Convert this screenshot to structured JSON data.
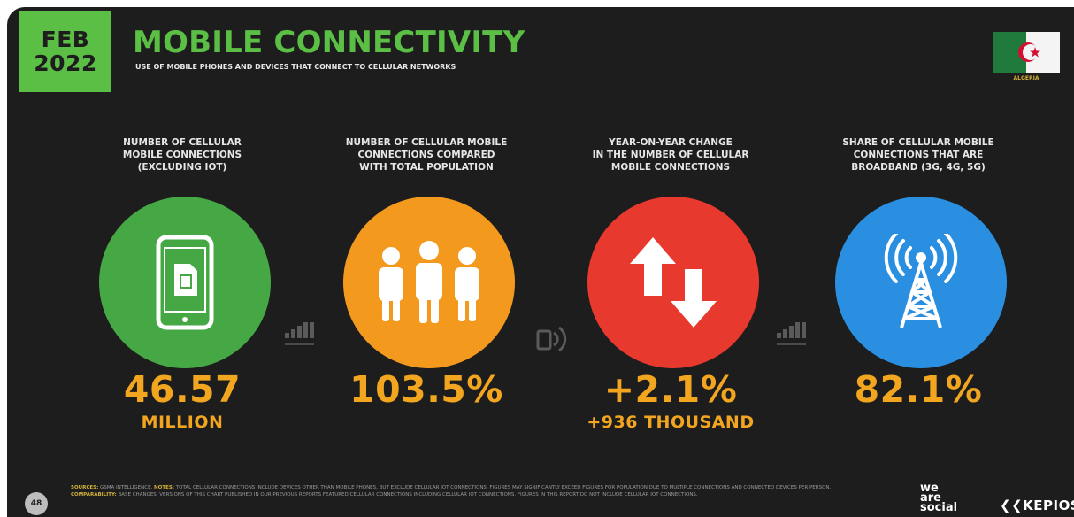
{
  "header": {
    "month": "FEB",
    "year": "2022",
    "title": "MOBILE CONNECTIVITY",
    "subtitle": "USE OF MOBILE PHONES AND DEVICES THAT CONNECT TO CELLULAR NETWORKS",
    "country": "ALGERIA",
    "flag_icon": "algeria-flag-icon"
  },
  "colors": {
    "brand_green": "#5bbf45",
    "accent_orange": "#f2a620",
    "circle_green": "#46a845",
    "circle_orange": "#f39a1e",
    "circle_red": "#e8392f",
    "circle_blue": "#2a8fe0",
    "background": "#1d1d1d"
  },
  "stats": [
    {
      "label": "NUMBER OF CELLULAR\nMOBILE CONNECTIONS\n(EXCLUDING IOT)",
      "icon": "mobile-phone-sim-icon",
      "value": "46.57",
      "sub": "MILLION"
    },
    {
      "label": "NUMBER OF CELLULAR MOBILE\nCONNECTIONS COMPARED\nWITH TOTAL POPULATION",
      "icon": "people-group-icon",
      "value": "103.5%",
      "sub": ""
    },
    {
      "label": "YEAR-ON-YEAR CHANGE\nIN THE NUMBER OF CELLULAR\nMOBILE CONNECTIONS",
      "icon": "up-down-arrows-icon",
      "value": "+2.1%",
      "sub": "+936 THOUSAND"
    },
    {
      "label": "SHARE OF CELLULAR MOBILE\nCONNECTIONS THAT ARE\nBROADBAND (3G, 4G, 5G)",
      "icon": "cell-tower-icon",
      "value": "82.1%",
      "sub": ""
    }
  ],
  "source_icons": [
    "gsma-intelligence-icon",
    "data-source-icon",
    "gsma-intelligence-icon"
  ],
  "footer": {
    "page_number": "48",
    "sources_label": "SOURCES:",
    "sources_text": "GSMA INTELLIGENCE.",
    "notes_label": "NOTES:",
    "notes_text": "TOTAL CELLULAR CONNECTIONS INCLUDE DEVICES OTHER THAN MOBILE PHONES, BUT EXCLUDE CELLULAR IOT CONNECTIONS. FIGURES MAY SIGNIFICANTLY EXCEED FIGURES FOR POPULATION DUE TO MULTIPLE CONNECTIONS AND CONNECTED DEVICES PER PERSON.",
    "comparability_label": "COMPARABILITY:",
    "comparability_text": "BASE CHANGES. VERSIONS OF THIS CHART PUBLISHED IN OUR PREVIOUS REPORTS FEATURED CELLULAR CONNECTIONS INCLUDING CELLULAR IOT CONNECTIONS. FIGURES IN THIS REPORT DO NOT INCLUDE CELLULAR IOT CONNECTIONS.",
    "brand_we": "we",
    "brand_are": "are",
    "brand_social": "social",
    "brand_kepios": "KEPIOS"
  }
}
